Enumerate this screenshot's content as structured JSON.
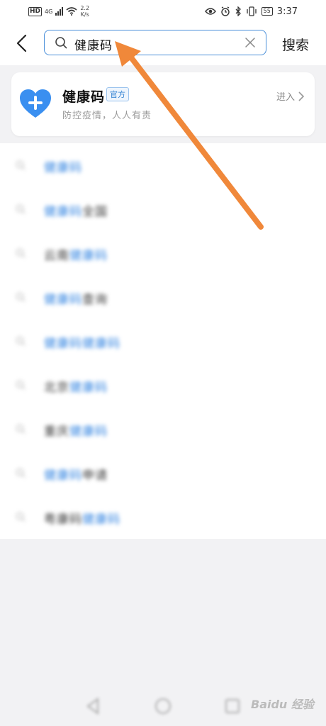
{
  "status_bar": {
    "hd": "HD",
    "network": "4G",
    "speed_value": "2.2",
    "speed_unit": "K/s",
    "battery": "55",
    "time": "3:37"
  },
  "header": {
    "query": "健康码",
    "search_label": "搜索"
  },
  "result_card": {
    "title": "健康码",
    "badge": "官方",
    "subtitle": "防控疫情，人人有责",
    "enter_label": "进入"
  },
  "suggestions": [
    {
      "prefix": "",
      "highlight": "健康码",
      "suffix": ""
    },
    {
      "prefix": "",
      "highlight": "健康码",
      "suffix": "全国"
    },
    {
      "prefix": "云南",
      "highlight": "健康码",
      "suffix": ""
    },
    {
      "prefix": "",
      "highlight": "健康码",
      "suffix": "查询"
    },
    {
      "prefix": "",
      "highlight": "健康码健康码",
      "suffix": ""
    },
    {
      "prefix": "北京",
      "highlight": "健康码",
      "suffix": ""
    },
    {
      "prefix": "重庆",
      "highlight": "健康码",
      "suffix": ""
    },
    {
      "prefix": "",
      "highlight": "健康码",
      "suffix": "申请"
    },
    {
      "prefix": "粤康码",
      "highlight": "健康码",
      "suffix": ""
    }
  ],
  "watermark": "Baidu 经验",
  "colors": {
    "accent": "#2a7fe0",
    "search_border": "#4a8fd9",
    "arrow": "#f0883a",
    "heart": "#3a8ff0"
  },
  "icons": {
    "back": "chevron-left-icon",
    "search": "search-icon",
    "clear": "close-icon",
    "card": "heart-plus-icon",
    "enter": "chevron-right-icon"
  }
}
